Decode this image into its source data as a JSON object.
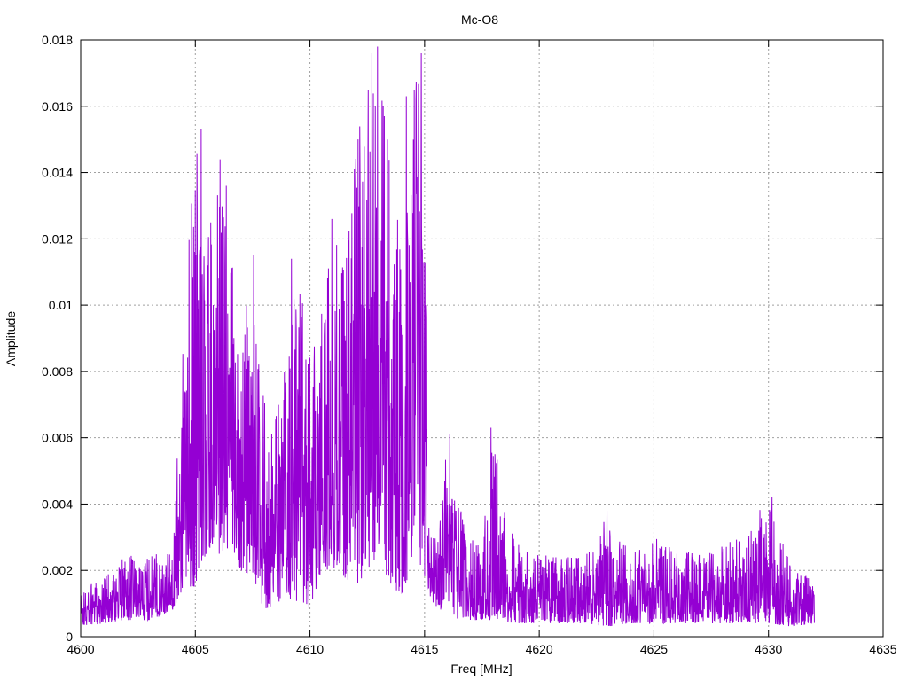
{
  "chart_data": {
    "type": "line",
    "title": "Mc-O8",
    "xlabel": "Freq [MHz]",
    "ylabel": "Amplitude",
    "xlim": [
      4600,
      4635
    ],
    "ylim": [
      0,
      0.018
    ],
    "x_ticks": [
      4600,
      4605,
      4610,
      4615,
      4620,
      4625,
      4630,
      4635
    ],
    "y_ticks": [
      0,
      0.002,
      0.004,
      0.006,
      0.008,
      0.01,
      0.012,
      0.014,
      0.016,
      0.018
    ],
    "x_tick_labels": [
      "4600",
      "4605",
      "4610",
      "4615",
      "4620",
      "4625",
      "4630",
      "4635"
    ],
    "y_tick_labels": [
      "0",
      "0.002",
      "0.004",
      "0.006",
      "0.008",
      "0.01",
      "0.012",
      "0.014",
      "0.016",
      "0.018"
    ],
    "grid": true,
    "legend": "none",
    "series": [
      {
        "color": "#9400d3",
        "envelope": {
          "x": [
            4600.0,
            4601.0,
            4602.0,
            4603.0,
            4604.0,
            4604.5,
            4605.0,
            4605.5,
            4606.0,
            4606.5,
            4607.0,
            4607.5,
            4608.0,
            4608.5,
            4609.0,
            4609.5,
            4610.0,
            4610.5,
            4611.0,
            4611.5,
            4612.0,
            4612.5,
            4613.0,
            4613.5,
            4614.0,
            4614.5,
            4614.9,
            4615.2,
            4615.6,
            4616.0,
            4616.5,
            4617.0,
            4617.5,
            4618.0,
            4619.0,
            4620.0,
            4621.0,
            4622.0,
            4623.0,
            4624.0,
            4625.0,
            4626.0,
            4627.0,
            4628.0,
            4629.0,
            4630.0,
            4631.0,
            4632.0
          ],
          "lo": [
            0.0003,
            0.0004,
            0.0005,
            0.0005,
            0.0008,
            0.0015,
            0.0015,
            0.0025,
            0.0025,
            0.0025,
            0.002,
            0.0018,
            0.0008,
            0.001,
            0.0012,
            0.001,
            0.0008,
            0.002,
            0.002,
            0.0018,
            0.0015,
            0.002,
            0.0025,
            0.0015,
            0.001,
            0.0025,
            0.002,
            0.0012,
            0.0008,
            0.0008,
            0.0005,
            0.0005,
            0.0005,
            0.0005,
            0.0004,
            0.0004,
            0.0004,
            0.0004,
            0.0003,
            0.0004,
            0.0004,
            0.0004,
            0.0004,
            0.0004,
            0.0004,
            0.0004,
            0.0003,
            0.0004
          ],
          "hi": [
            0.0014,
            0.0018,
            0.0025,
            0.0025,
            0.0025,
            0.0095,
            0.015,
            0.012,
            0.0142,
            0.0122,
            0.0096,
            0.0105,
            0.0072,
            0.0068,
            0.009,
            0.0112,
            0.0085,
            0.0098,
            0.0125,
            0.011,
            0.0146,
            0.0175,
            0.0178,
            0.015,
            0.012,
            0.0165,
            0.0177,
            0.003,
            0.003,
            0.006,
            0.0042,
            0.003,
            0.0028,
            0.0062,
            0.003,
            0.0025,
            0.0024,
            0.0024,
            0.0037,
            0.0025,
            0.003,
            0.0026,
            0.0025,
            0.0028,
            0.0032,
            0.0042,
            0.0024,
            0.0016
          ]
        },
        "peaks": [
          {
            "x": 4605.25,
            "y": 0.0153
          },
          {
            "x": 4606.08,
            "y": 0.0144
          },
          {
            "x": 4606.35,
            "y": 0.0136
          },
          {
            "x": 4607.55,
            "y": 0.0115
          },
          {
            "x": 4609.2,
            "y": 0.0114
          },
          {
            "x": 4610.95,
            "y": 0.0126
          },
          {
            "x": 4612.1,
            "y": 0.015
          },
          {
            "x": 4612.7,
            "y": 0.0176
          },
          {
            "x": 4612.95,
            "y": 0.0178
          },
          {
            "x": 4613.2,
            "y": 0.016
          },
          {
            "x": 4614.2,
            "y": 0.0163
          },
          {
            "x": 4614.85,
            "y": 0.0176
          },
          {
            "x": 4616.1,
            "y": 0.0061
          },
          {
            "x": 4617.9,
            "y": 0.0063
          },
          {
            "x": 4622.95,
            "y": 0.0038
          },
          {
            "x": 4630.15,
            "y": 0.0042
          }
        ],
        "points": 2600
      }
    ]
  }
}
